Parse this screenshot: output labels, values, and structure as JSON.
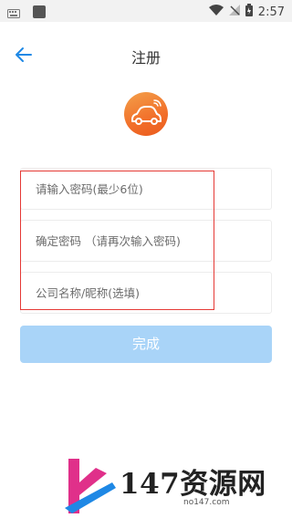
{
  "status_bar": {
    "time": "2:57"
  },
  "header": {
    "title": "注册"
  },
  "form": {
    "password_placeholder": "请输入密码(最少6位)",
    "confirm_placeholder": "确定密码 （请再次输入密码)",
    "company_placeholder": "公司名称/昵称(选填)"
  },
  "submit_label": "完成",
  "watermark": {
    "brand": "147资源网",
    "url": "no147.com"
  },
  "colors": {
    "accent": "#1e88e5",
    "logo": "#f26f2a",
    "button_disabled": "#a9d4f8",
    "highlight": "#e53935"
  }
}
